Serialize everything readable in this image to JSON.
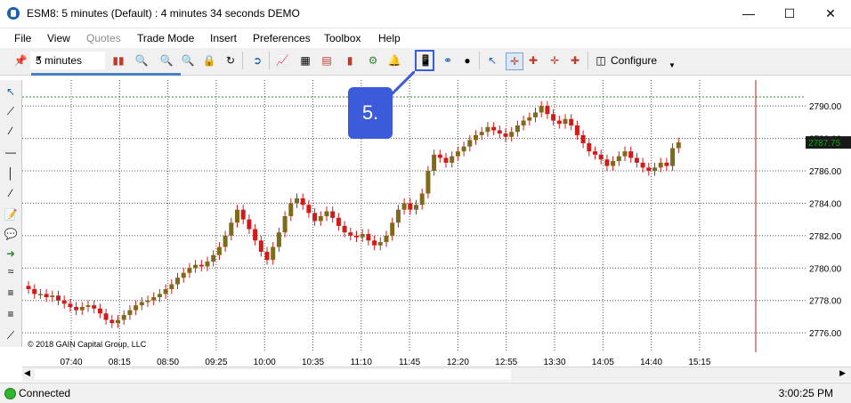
{
  "window": {
    "title": "ESM8: 5 minutes (Default) : 4 minutes 34 seconds DEMO"
  },
  "menu": {
    "items": [
      "File",
      "View",
      "Quotes",
      "Trade Mode",
      "Insert",
      "Preferences",
      "Toolbox",
      "Help"
    ]
  },
  "toolbar": {
    "interval": "5 minutes",
    "configure": "Configure"
  },
  "callout": {
    "label": "5."
  },
  "chart": {
    "copyright": "© 2018 GAIN Capital Group, LLC",
    "ylabels": [
      "2790.00",
      "2788.00",
      "2786.00",
      "2784.00",
      "2782.00",
      "2780.00",
      "2778.00",
      "2776.00"
    ],
    "xlabels": [
      "07:40",
      "08:15",
      "08:50",
      "09:25",
      "10:00",
      "10:35",
      "11:10",
      "11:45",
      "12:20",
      "12:55",
      "13:30",
      "14:05",
      "14:40",
      "15:15"
    ],
    "current_price": "2787.75",
    "colors": {
      "candle": "#d11a1a",
      "current": "#00aa00"
    }
  },
  "chart_data": {
    "type": "candlestick",
    "ylim": [
      2774.8,
      2791.6
    ],
    "x_ticks": [
      "07:40",
      "08:15",
      "08:50",
      "09:25",
      "10:00",
      "10:35",
      "11:10",
      "11:45",
      "12:20",
      "12:55",
      "13:30",
      "14:05",
      "14:40",
      "15:15"
    ],
    "last_price": 2787.75,
    "closes": [
      2778.7,
      2778.4,
      2778.4,
      2778.2,
      2778.3,
      2778.0,
      2777.8,
      2777.6,
      2777.4,
      2777.6,
      2777.7,
      2777.5,
      2777.2,
      2776.8,
      2776.6,
      2776.8,
      2777.1,
      2777.4,
      2777.7,
      2777.9,
      2778.0,
      2778.2,
      2778.4,
      2778.7,
      2779.0,
      2779.4,
      2779.7,
      2780.0,
      2780.2,
      2780.1,
      2780.4,
      2780.8,
      2781.3,
      2782.0,
      2782.8,
      2783.6,
      2783.0,
      2782.4,
      2781.7,
      2781.0,
      2780.5,
      2781.3,
      2782.2,
      2783.2,
      2784.0,
      2784.3,
      2783.9,
      2783.4,
      2782.9,
      2783.2,
      2783.5,
      2783.1,
      2782.6,
      2782.2,
      2782.0,
      2781.9,
      2782.1,
      2781.7,
      2781.4,
      2781.6,
      2782.0,
      2782.8,
      2783.6,
      2784.0,
      2783.6,
      2783.9,
      2784.6,
      2786.0,
      2787.0,
      2786.8,
      2786.5,
      2786.9,
      2787.2,
      2787.5,
      2787.9,
      2788.2,
      2788.4,
      2788.7,
      2788.5,
      2788.3,
      2788.1,
      2788.4,
      2788.8,
      2789.1,
      2789.3,
      2789.6,
      2790.0,
      2789.5,
      2789.1,
      2788.9,
      2789.2,
      2788.8,
      2788.2,
      2787.7,
      2787.2,
      2787.0,
      2786.7,
      2786.3,
      2786.6,
      2786.9,
      2787.2,
      2786.8,
      2786.5,
      2786.2,
      2786.0,
      2786.2,
      2786.5,
      2786.3,
      2787.4,
      2787.75
    ]
  },
  "status": {
    "text": "Connected",
    "time": "3:00:25 PM"
  }
}
